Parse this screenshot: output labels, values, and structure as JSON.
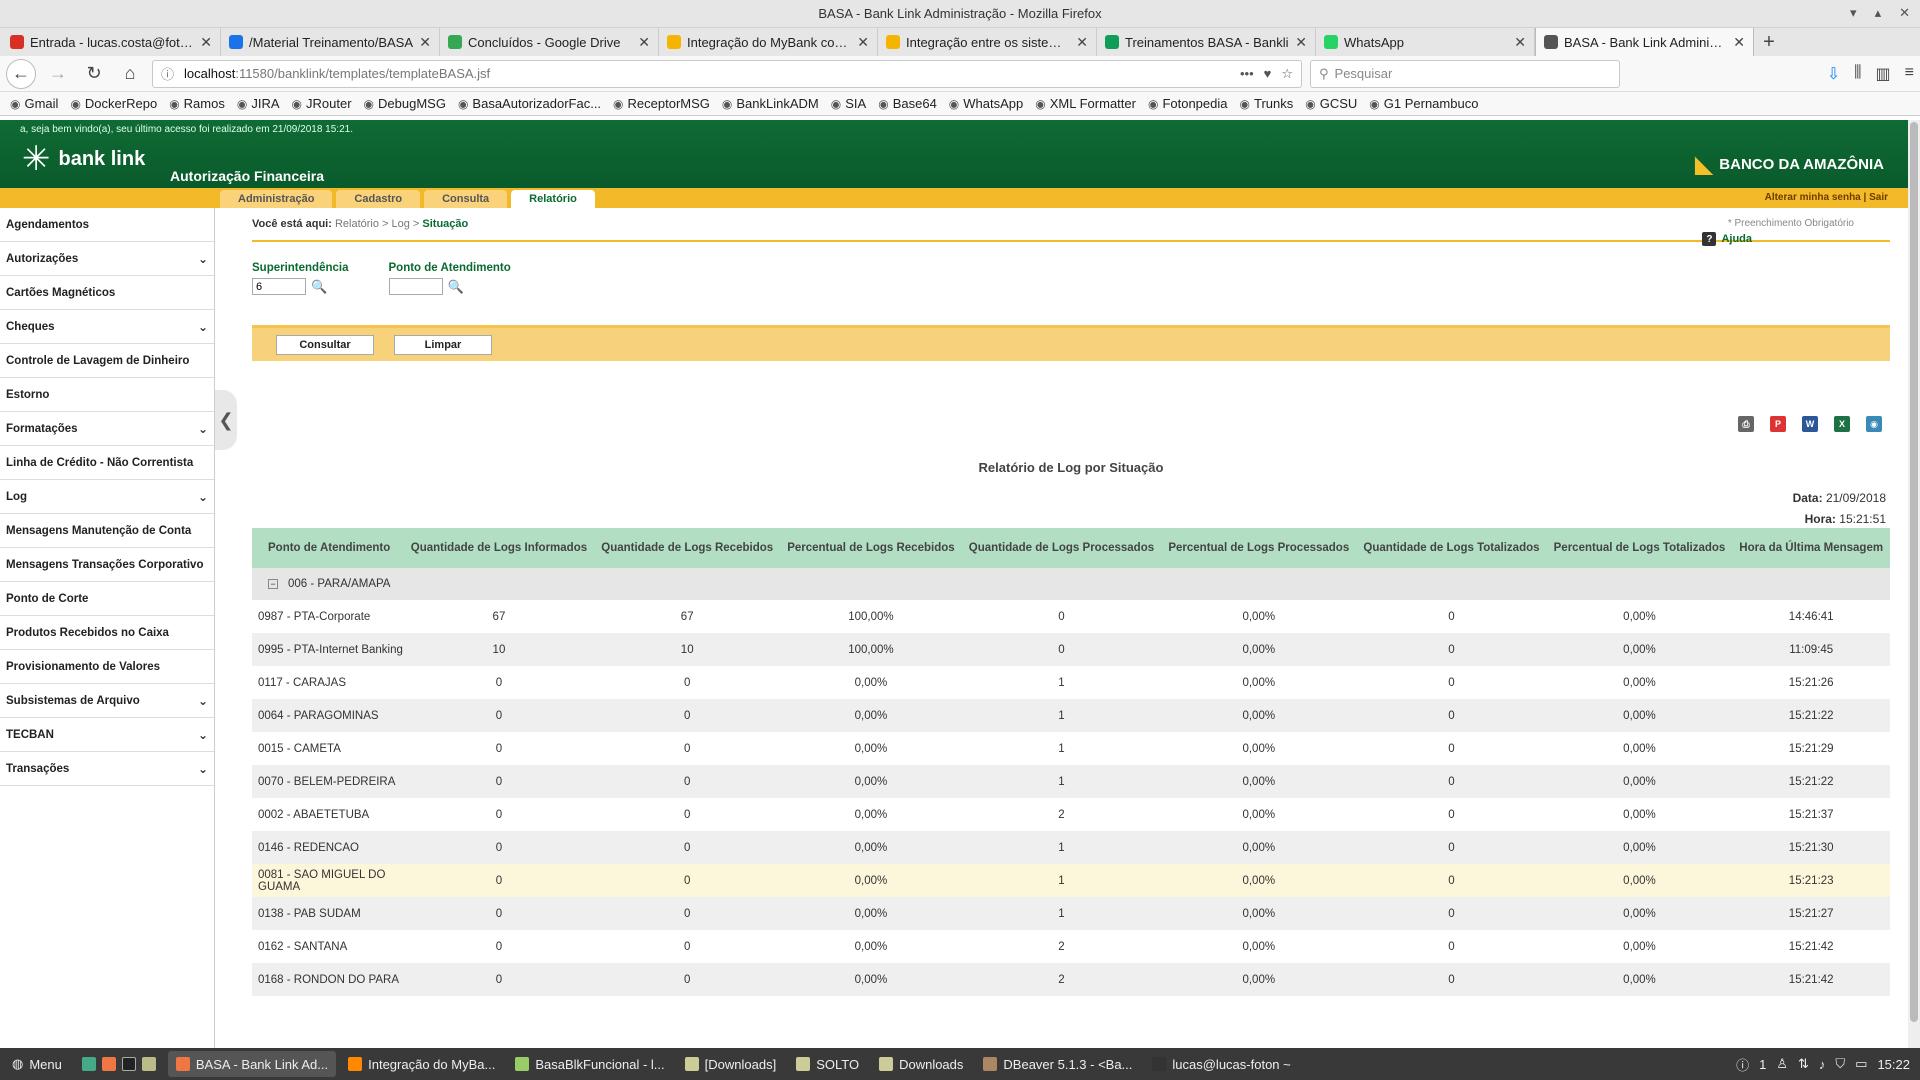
{
  "window": {
    "title": "BASA - Bank Link Administração - Mozilla Firefox"
  },
  "tabs": [
    {
      "label": "Entrada - lucas.costa@foton.l",
      "color": "#d93025"
    },
    {
      "label": "/Material Treinamento/BASA",
      "color": "#1a73e8"
    },
    {
      "label": "Concluídos - Google Drive",
      "color": "#34a853"
    },
    {
      "label": "Integração do MyBank com B",
      "color": "#f4b400"
    },
    {
      "label": "Integração entre os sistemas",
      "color": "#f4b400"
    },
    {
      "label": "Treinamentos BASA - Bankli",
      "color": "#0f9d58"
    },
    {
      "label": "WhatsApp",
      "color": "#25d366"
    },
    {
      "label": "BASA - Bank Link Administraç",
      "color": "#555555"
    }
  ],
  "nav": {
    "url_host": "localhost",
    "url_path": ":11580/banklink/templates/templateBASA.jsf",
    "search_placeholder": "Pesquisar"
  },
  "bookmarks": [
    "Gmail",
    "DockerRepo",
    "Ramos",
    "JIRA",
    "JRouter",
    "DebugMSG",
    "BasaAutorizadorFac...",
    "ReceptorMSG",
    "BankLinkADM",
    "SIA",
    "Base64",
    "WhatsApp",
    "XML Formatter",
    "Fotonpedia",
    "Trunks",
    "GCSU",
    "G1 Pernambuco"
  ],
  "header": {
    "welcome": "a, seja bem vindo(a), seu último acesso foi realizado em 21/09/2018 15:21.",
    "logo": "bank link",
    "subtitle": "Autorização Financeira",
    "bank": "BANCO DA AMAZÔNIA",
    "account_links": "Alterar minha senha  |  Sair"
  },
  "menu_tabs": [
    "Administração",
    "Cadastro",
    "Consulta",
    "Relatório"
  ],
  "sidebar": [
    {
      "label": "Agendamentos",
      "chev": ""
    },
    {
      "label": "Autorizações",
      "chev": "⌄"
    },
    {
      "label": "Cartões Magnéticos",
      "chev": ""
    },
    {
      "label": "Cheques",
      "chev": "⌄"
    },
    {
      "label": "Controle de Lavagem de Dinheiro",
      "chev": ""
    },
    {
      "label": "Estorno",
      "chev": ""
    },
    {
      "label": "Formatações",
      "chev": "⌄"
    },
    {
      "label": "Linha de Crédito - Não Correntista",
      "chev": ""
    },
    {
      "label": "Log",
      "chev": "⌄"
    },
    {
      "label": "Mensagens Manutenção de Conta",
      "chev": ""
    },
    {
      "label": "Mensagens Transações Corporativo",
      "chev": ""
    },
    {
      "label": "Ponto de Corte",
      "chev": ""
    },
    {
      "label": "Produtos Recebidos no Caixa",
      "chev": ""
    },
    {
      "label": "Provisionamento de Valores",
      "chev": ""
    },
    {
      "label": "Subsistemas de Arquivo",
      "chev": "⌄"
    },
    {
      "label": "TECBAN",
      "chev": "⌄"
    },
    {
      "label": "Transações",
      "chev": "⌄"
    }
  ],
  "breadcrumb": {
    "prefix": "Você está aqui:",
    "path": "Relatório > Log >",
    "current": "Situação"
  },
  "required_note": "* Preenchimento Obrigatório",
  "help": "Ajuda",
  "filters": {
    "sup_label": "Superintendência",
    "sup_value": "6",
    "pa_label": "Ponto de Atendimento",
    "pa_value": ""
  },
  "buttons": {
    "consultar": "Consultar",
    "limpar": "Limpar"
  },
  "report": {
    "title": "Relatório de Log por Situação",
    "date_label": "Data:",
    "date": "21/09/2018",
    "time_label": "Hora:",
    "time": "15:21:51",
    "columns": [
      "Ponto de Atendimento",
      "Quantidade de Logs Informados",
      "Quantidade de Logs Recebidos",
      "Percentual de Logs Recebidos",
      "Quantidade de Logs Processados",
      "Percentual de Logs Processados",
      "Quantidade de Logs Totalizados",
      "Percentual de Logs Totalizados",
      "Hora da Última Mensagem"
    ],
    "group": "006 - PARA/AMAPA",
    "rows": [
      [
        "0987 - PTA-Corporate",
        "67",
        "67",
        "100,00%",
        "0",
        "0,00%",
        "0",
        "0,00%",
        "14:46:41"
      ],
      [
        "0995 - PTA-Internet Banking",
        "10",
        "10",
        "100,00%",
        "0",
        "0,00%",
        "0",
        "0,00%",
        "11:09:45"
      ],
      [
        "0117 - CARAJAS",
        "0",
        "0",
        "0,00%",
        "1",
        "0,00%",
        "0",
        "0,00%",
        "15:21:26"
      ],
      [
        "0064 - PARAGOMINAS",
        "0",
        "0",
        "0,00%",
        "1",
        "0,00%",
        "0",
        "0,00%",
        "15:21:22"
      ],
      [
        "0015 - CAMETA",
        "0",
        "0",
        "0,00%",
        "1",
        "0,00%",
        "0",
        "0,00%",
        "15:21:29"
      ],
      [
        "0070 - BELEM-PEDREIRA",
        "0",
        "0",
        "0,00%",
        "1",
        "0,00%",
        "0",
        "0,00%",
        "15:21:22"
      ],
      [
        "0002 - ABAETETUBA",
        "0",
        "0",
        "0,00%",
        "2",
        "0,00%",
        "0",
        "0,00%",
        "15:21:37"
      ],
      [
        "0146 - REDENCAO",
        "0",
        "0",
        "0,00%",
        "1",
        "0,00%",
        "0",
        "0,00%",
        "15:21:30"
      ],
      [
        "0081 - SAO MIGUEL DO GUAMA",
        "0",
        "0",
        "0,00%",
        "1",
        "0,00%",
        "0",
        "0,00%",
        "15:21:23"
      ],
      [
        "0138 - PAB SUDAM",
        "0",
        "0",
        "0,00%",
        "1",
        "0,00%",
        "0",
        "0,00%",
        "15:21:27"
      ],
      [
        "0162 - SANTANA",
        "0",
        "0",
        "0,00%",
        "2",
        "0,00%",
        "0",
        "0,00%",
        "15:21:42"
      ],
      [
        "0168 - RONDON DO PARA",
        "0",
        "0",
        "0,00%",
        "2",
        "0,00%",
        "0",
        "0,00%",
        "15:21:42"
      ]
    ],
    "highlight_row": 8
  },
  "taskbar": {
    "menu": "Menu",
    "items": [
      "BASA - Bank Link Ad...",
      "Integração do MyBa...",
      "BasaBlkFuncional - l...",
      "[Downloads]",
      "SOLTO",
      "Downloads",
      "DBeaver 5.1.3 - <Ba...",
      "lucas@lucas-foton ~"
    ],
    "clock": "15:22",
    "tray_num": "1"
  }
}
